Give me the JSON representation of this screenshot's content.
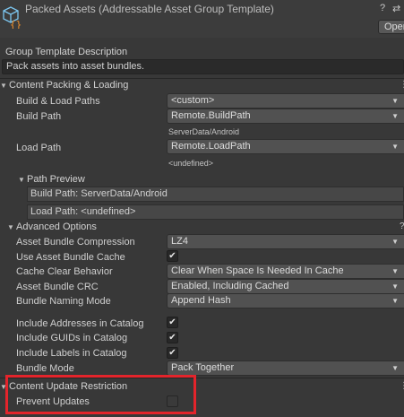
{
  "header": {
    "title": "Packed Assets (Addressable Asset Group Template)",
    "open_label": "Oper",
    "help_icon": "help-icon",
    "settings_icon": "preset-icon"
  },
  "description": {
    "label": "Group Template Description",
    "value": "Pack assets into asset bundles."
  },
  "content_packing": {
    "header": "Content Packing & Loading",
    "build_load_paths_label": "Build & Load Paths",
    "build_load_paths_value": "<custom>",
    "build_path_label": "Build Path",
    "build_path_value": "Remote.BuildPath",
    "build_path_resolved": "ServerData/Android",
    "load_path_label": "Load Path",
    "load_path_value": "Remote.LoadPath",
    "load_path_resolved": "<undefined>",
    "path_preview": {
      "header": "Path Preview",
      "build_path": "Build Path: ServerData/Android",
      "load_path": "Load Path: <undefined>"
    },
    "advanced": {
      "header": "Advanced Options",
      "compression_label": "Asset Bundle Compression",
      "compression_value": "LZ4",
      "use_cache_label": "Use Asset Bundle Cache",
      "use_cache": true,
      "cache_clear_label": "Cache Clear Behavior",
      "cache_clear_value": "Clear When Space Is Needed In Cache",
      "crc_label": "Asset Bundle CRC",
      "crc_value": "Enabled, Including Cached",
      "naming_label": "Bundle Naming Mode",
      "naming_value": "Append Hash",
      "include_addresses_label": "Include Addresses in Catalog",
      "include_addresses": true,
      "include_guids_label": "Include GUIDs in Catalog",
      "include_guids": true,
      "include_labels_label": "Include Labels in Catalog",
      "include_labels": true,
      "bundle_mode_label": "Bundle Mode",
      "bundle_mode_value": "Pack Together"
    }
  },
  "content_update": {
    "header": "Content Update Restriction",
    "prevent_updates_label": "Prevent Updates",
    "prevent_updates": false
  },
  "glyphs": {
    "fold_open": "▼",
    "dropdown_arrow": "▼",
    "check": "✔",
    "help": "?",
    "settings": "⇄",
    "menu": "⋮"
  },
  "colors": {
    "background": "#383838",
    "highlight": "#e3242b"
  }
}
